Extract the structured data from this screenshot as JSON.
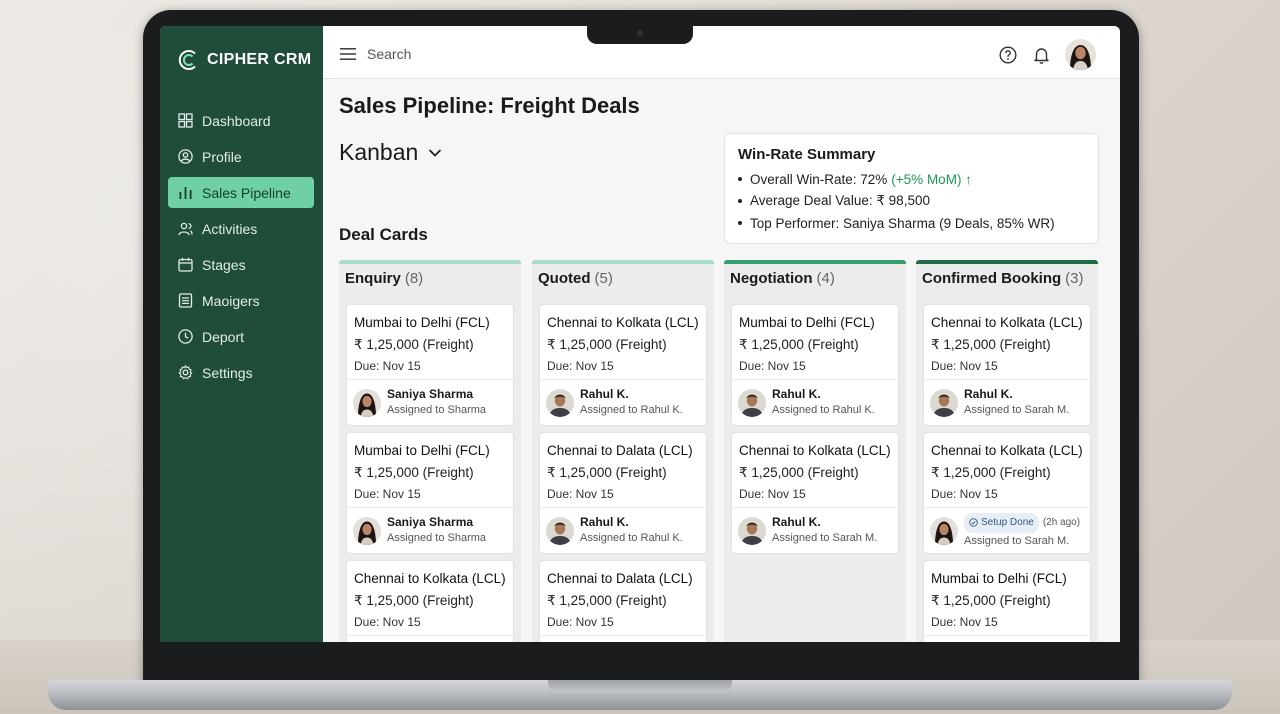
{
  "app": {
    "brand": "CIPHER CRM"
  },
  "sidebar": {
    "items": [
      {
        "label": "Dashboard",
        "icon": "grid-icon"
      },
      {
        "label": "Profile",
        "icon": "user-circle-icon"
      },
      {
        "label": "Sales Pipeline",
        "icon": "bar-chart-icon",
        "active": true
      },
      {
        "label": "Activities",
        "icon": "people-icon"
      },
      {
        "label": "Stages",
        "icon": "calendar-icon"
      },
      {
        "label": "Maoigers",
        "icon": "list-doc-icon"
      },
      {
        "label": "Deport",
        "icon": "clock-icon"
      },
      {
        "label": "Settings",
        "icon": "gear-icon"
      }
    ]
  },
  "topbar": {
    "search_placeholder": "Search"
  },
  "page": {
    "title": "Sales Pipeline: Freight Deals",
    "view": "Kanban",
    "deal_cards_heading": "Deal Cards"
  },
  "winrate": {
    "title": "Win-Rate Summary",
    "overall": "Overall Win-Rate: 72%",
    "overall_change": "(+5% MoM) ↑",
    "avg_value": "Average Deal Value: ₹ 98,500",
    "top_performer": "Top Performer: Saniya Sharma (9 Deals, 85% WR)"
  },
  "columns": [
    {
      "name": "Enquiry",
      "count": "(8)",
      "cards": [
        {
          "route": "Mumbai to Delhi (FCL)",
          "value": "₹ 1,25,000 (Freight)",
          "due": "Due: Nov 15",
          "name": "Saniya Sharma",
          "assigned": "Assigned to Sharma",
          "gender": "f"
        },
        {
          "route": "Mumbai to Delhi (FCL)",
          "value": "₹ 1,25,000 (Freight)",
          "due": "Due: Nov 15",
          "name": "Saniya Sharma",
          "assigned": "Assigned to Sharma",
          "gender": "f"
        },
        {
          "route": "Chennai to Kolkata (LCL)",
          "value": "₹ 1,25,000 (Freight)",
          "due": "Due: Nov 15",
          "name": "",
          "assigned": "",
          "gender": "f"
        }
      ]
    },
    {
      "name": "Quoted",
      "count": "(5)",
      "cards": [
        {
          "route": "Chennai to Kolkata (LCL)",
          "value": "₹ 1,25,000 (Freight)",
          "due": "Due: Nov 15",
          "name": "Rahul K.",
          "assigned": "Assigned to Rahul K.",
          "gender": "m"
        },
        {
          "route": "Chennai to Dalata (LCL)",
          "value": "₹ 1,25,000 (Freight)",
          "due": "Due: Nov 15",
          "name": "Rahul K.",
          "assigned": "Assigned to Rahul K.",
          "gender": "m"
        },
        {
          "route": "Chennai to Dalata (LCL)",
          "value": "₹ 1,25,000 (Freight)",
          "due": "Due: Nov 15",
          "name": "",
          "assigned": "",
          "gender": "m"
        }
      ]
    },
    {
      "name": "Negotiation",
      "count": "(4)",
      "cards": [
        {
          "route": "Mumbai to Delhi (FCL)",
          "value": "₹ 1,25,000 (Freight)",
          "due": "Due: Nov 15",
          "name": "Rahul K.",
          "assigned": "Assigned to Rahul K.",
          "gender": "m"
        },
        {
          "route": "Chennai to Kolkata (LCL)",
          "value": "₹ 1,25,000 (Freight)",
          "due": "Due: Nov 15",
          "name": "Rahul K.",
          "assigned": "Assigned to Sarah M.",
          "gender": "m"
        }
      ]
    },
    {
      "name": "Confirmed Booking",
      "count": "(3)",
      "cards": [
        {
          "route": "Chennai to Kolkata (LCL)",
          "value": "₹ 1,25,000 (Freight)",
          "due": "Due: Nov 15",
          "name": "Rahul K.",
          "assigned": "Assigned to Sarah M.",
          "gender": "m"
        },
        {
          "route": "Chennai to Kolkata (LCL)",
          "value": "₹ 1,25,000 (Freight)",
          "due": "Due: Nov 15",
          "chip": "Setup Done",
          "chip_time": "(2h ago)",
          "assigned": "Assigned to Sarah M.",
          "gender": "f"
        },
        {
          "route": "Mumbai to Delhi (FCL)",
          "value": "₹ 1,25,000 (Freight)",
          "due": "Due: Nov 15",
          "name": "",
          "assigned": "",
          "gender": "f"
        }
      ]
    }
  ],
  "colors": {
    "sidebar_bg": "#1f4d3a",
    "active_nav": "#6fd0a8",
    "positive": "#1e9a52"
  }
}
